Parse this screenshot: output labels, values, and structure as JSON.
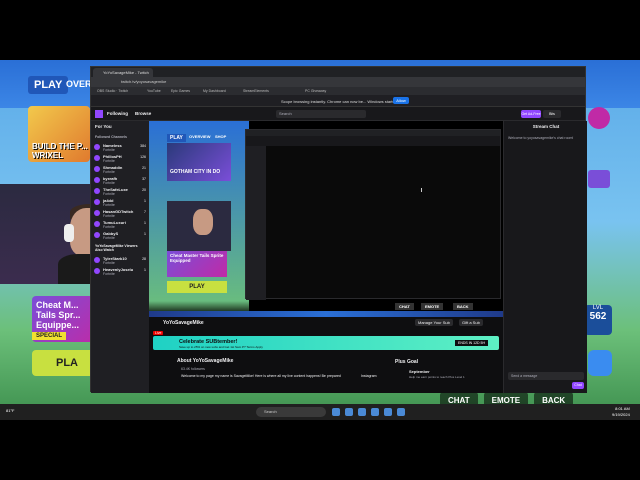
{
  "game": {
    "play": "PLAY",
    "overview": "OVER",
    "card_text": "BUILD THE P... WRIXEL",
    "cheat_text": "Cheat M... Tails Spr... Equippe...",
    "special": "SPECIAL",
    "play_big": "PLA",
    "lvl_label": "LVL",
    "lvl_value": "562",
    "bottom_buttons": [
      "CHAT",
      "EMOTE",
      "BACK"
    ]
  },
  "browser": {
    "tabs": [
      "YoYoSavageMike - Twitch",
      "",
      ""
    ],
    "url": "twitch.tv/yoyosavagemike",
    "bookmarks": [
      "OBS Studio · Twitch",
      "YouTube",
      "Epic Games",
      "My Dashboard",
      "StreamElements",
      "PC Giveaway"
    ],
    "notice": "Scope browsing instantly. Chrome can now be... Windows starts.",
    "notice_btn": "Allow"
  },
  "twitch": {
    "nav": [
      "Following",
      "Browse"
    ],
    "search_placeholder": "Search",
    "get_btn": "Get Ad-Free",
    "sub_btn": "Bits",
    "sidebar_title": "For You",
    "sidebar_sections": [
      "Followed Channels"
    ],
    "sidebar_items": [
      {
        "name": "Nameless",
        "game": "Fortnite",
        "count": "384"
      },
      {
        "name": "PhillosPH",
        "game": "Fortnite",
        "count": "126"
      },
      {
        "name": "Shmaddin",
        "game": "Fortnite",
        "count": "21"
      },
      {
        "name": "kyxrafh",
        "game": "Fortnite",
        "count": "37"
      },
      {
        "name": "TheSafeLuxe",
        "game": "Fortnite",
        "count": "20"
      },
      {
        "name": "ja4dd",
        "game": "Fortnite",
        "count": "1"
      },
      {
        "name": "HasanGDTwitch",
        "game": "Fortnite",
        "count": "7"
      },
      {
        "name": "TumuLuxuri",
        "game": "Fortnite",
        "count": "1"
      },
      {
        "name": "GabbyS",
        "game": "Fortnite",
        "count": "1"
      }
    ],
    "sidebar_footer": "YoYoSavageMike Viewers Also Watch",
    "sidebar_more": [
      {
        "name": "TylerStark10",
        "game": "Fortnite",
        "count": "28"
      },
      {
        "name": "HeavenlyJoselu",
        "game": "Fortnite",
        "count": "1"
      }
    ],
    "player_game": {
      "play": "PLAY",
      "overview": "OVERVIEW",
      "shop": "SHOP",
      "gotham": "GOTHAM CITY IN DO",
      "cheat": "Cheat Master Tails Sprite Equipped",
      "play_btn": "PLAY"
    },
    "player_buttons": [
      "CHAT",
      "EMOTE",
      "BACK"
    ],
    "channel_name": "YoYoSavageMike",
    "manage_btn": "Manage Your Sub",
    "gift_btn": "Gift a Sub",
    "live": "Live",
    "sub_banner_title": "Celebrate SUBtember!",
    "sub_banner_sub": "Save up to 25% on new subs and Get 1st Sam P? Terms Apply",
    "sub_banner_deal": "ENDS IN 12D 5H",
    "about_title": "About YoYoSavageMike",
    "followers": "63.4K followers",
    "about_desc": "Welcome to my page my name is SavageMike! Here is where all my live content happens! Be prepared",
    "instagram": "Instagram",
    "plus_goal": "Plus Goal",
    "goal_month": "September",
    "goal_desc": "Help me earn points to reach Plus Level 1",
    "chat_title": "Stream Chat",
    "chat_welcome": "Welcome to yoyosavagemike's chat room!",
    "chat_placeholder": "Send a message",
    "chat_send": "Chat"
  },
  "taskbar": {
    "search": "Search",
    "clock_time": "8:01 AM",
    "clock_date": "9/19/2024",
    "weather": "81°F"
  }
}
